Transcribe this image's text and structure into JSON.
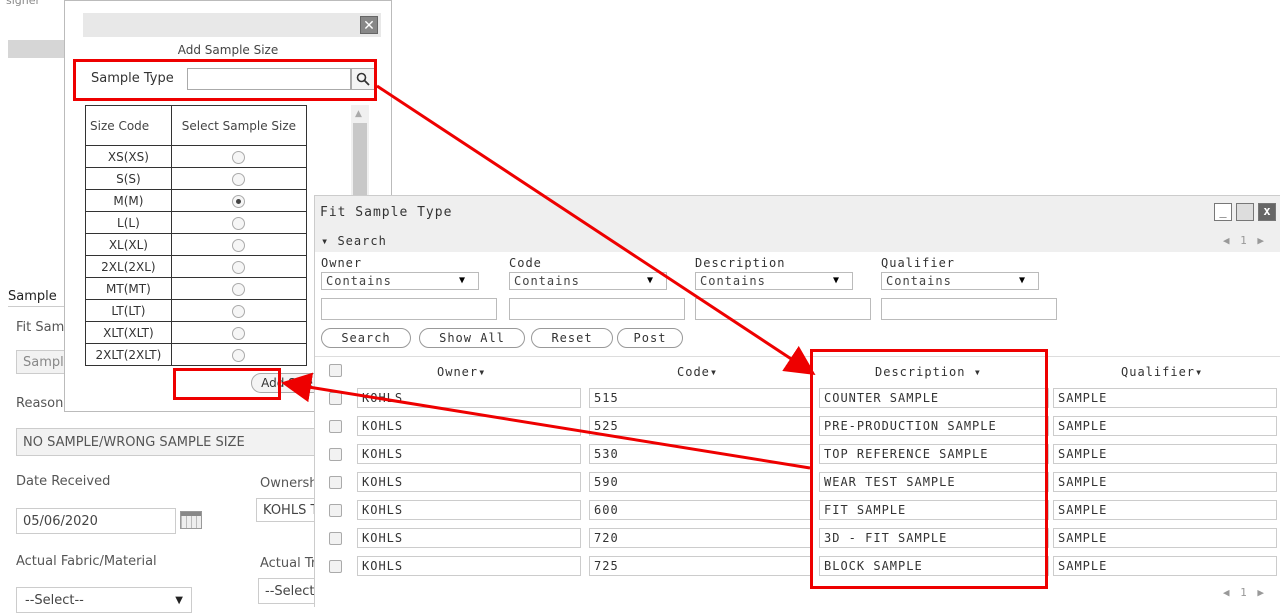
{
  "background_form": {
    "top_cut_text": "signer",
    "section_label": "Sample",
    "fit_sample_label": "Fit Sam",
    "sample_field_value": "Sample",
    "reason_label": "Reason",
    "reason_value": "NO SAMPLE/WRONG SAMPLE SIZE",
    "date_received_label": "Date Received",
    "date_received_value": "05/06/2020",
    "ownership_label": "Ownersh",
    "ownership_value": "KOHLS T",
    "actual_fabric_label": "Actual Fabric/Material",
    "actual_fabric_value": "--Select--",
    "actual_tr_label": "Actual Tr",
    "actual_tr_value": "--Select"
  },
  "size_popup": {
    "heading": "Add Sample Size",
    "close_glyph": "✕",
    "sample_type_label": "Sample Type",
    "sample_type_value": "",
    "table_headers": [
      "Size Code",
      "Select Sample Size"
    ],
    "sizes": [
      {
        "code": "XS(XS)",
        "selected": false
      },
      {
        "code": "S(S)",
        "selected": false
      },
      {
        "code": "M(M)",
        "selected": true
      },
      {
        "code": "L(L)",
        "selected": false
      },
      {
        "code": "XL(XL)",
        "selected": false
      },
      {
        "code": "2XL(2XL)",
        "selected": false
      },
      {
        "code": "MT(MT)",
        "selected": false
      },
      {
        "code": "LT(LT)",
        "selected": false
      },
      {
        "code": "XLT(XLT)",
        "selected": false
      },
      {
        "code": "2XLT(2XLT)",
        "selected": false
      }
    ],
    "add_size_label": "Add Size"
  },
  "fit_window": {
    "title": "Fit Sample Type",
    "search_toggle": "Search",
    "pager_top": "◀ 1 ▶",
    "pager_bottom": "◀ 1 ▶",
    "filters": [
      {
        "label": "Owner",
        "operator": "Contains"
      },
      {
        "label": "Code",
        "operator": "Contains"
      },
      {
        "label": "Description",
        "operator": "Contains"
      },
      {
        "label": "Qualifier",
        "operator": "Contains"
      }
    ],
    "buttons": {
      "search": "Search",
      "show_all": "Show All",
      "reset": "Reset",
      "post": "Post"
    },
    "columns": [
      "Owner",
      "Code",
      "Description",
      "Qualifier"
    ],
    "rows": [
      {
        "owner": "KOHLS",
        "code": "515",
        "description": "COUNTER SAMPLE",
        "qualifier": "SAMPLE"
      },
      {
        "owner": "KOHLS",
        "code": "525",
        "description": "PRE-PRODUCTION SAMPLE",
        "qualifier": "SAMPLE"
      },
      {
        "owner": "KOHLS",
        "code": "530",
        "description": "TOP REFERENCE SAMPLE",
        "qualifier": "SAMPLE"
      },
      {
        "owner": "KOHLS",
        "code": "590",
        "description": "WEAR TEST SAMPLE",
        "qualifier": "SAMPLE"
      },
      {
        "owner": "KOHLS",
        "code": "600",
        "description": "FIT SAMPLE",
        "qualifier": "SAMPLE"
      },
      {
        "owner": "KOHLS",
        "code": "720",
        "description": "3D - FIT SAMPLE",
        "qualifier": "SAMPLE"
      },
      {
        "owner": "KOHLS",
        "code": "725",
        "description": "BLOCK SAMPLE",
        "qualifier": "SAMPLE"
      }
    ]
  },
  "colors": {
    "highlight": "#e00000"
  }
}
